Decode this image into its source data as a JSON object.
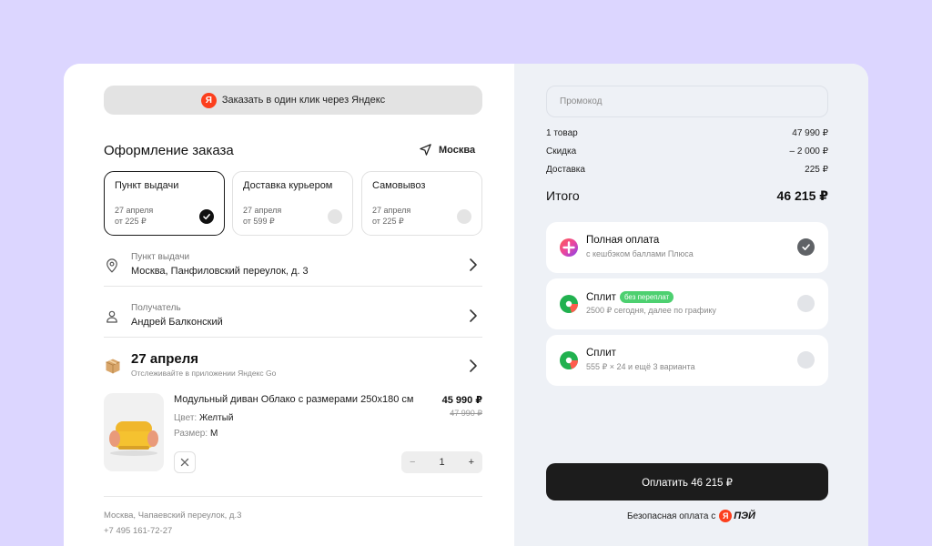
{
  "yandex_button": {
    "logo": "Я",
    "label": "Заказать в один клик через Яндекс"
  },
  "checkout": {
    "title": "Оформление заказа",
    "city": "Москва"
  },
  "delivery_options": [
    {
      "name": "Пункт выдачи",
      "date": "27 апреля",
      "price": "от 225 ₽",
      "selected": true
    },
    {
      "name": "Доставка курьером",
      "date": "27 апреля",
      "price": "от 599 ₽",
      "selected": false
    },
    {
      "name": "Самовывоз",
      "date": "27 апреля",
      "price": "от 225 ₽",
      "selected": false
    }
  ],
  "pickup": {
    "label": "Пункт выдачи",
    "value": "Москва, Панфиловский переулок, д. 3",
    "icon": "location-pin-icon"
  },
  "recipient": {
    "label": "Получатель",
    "value": "Андрей Балконский",
    "icon": "person-icon"
  },
  "shipment": {
    "date": "27 апреля",
    "subtitle": "Отслеживайте в приложении Яндекс Go",
    "icon": "box-icon"
  },
  "product": {
    "name": "Модульный диван Облако с размерами 250х180 см",
    "price": "45 990 ₽",
    "old_price": "47 990 ₽",
    "color_label": "Цвет:",
    "color_value": "Желтый",
    "size_label": "Размер:",
    "size_value": "M",
    "quantity": "1",
    "minus": "−",
    "plus": "+"
  },
  "shop": {
    "address": "Москва, Чапаевский переулок, д.3",
    "phone": "+7 495 161-72-27"
  },
  "summary": {
    "promo_placeholder": "Промокод",
    "rows": [
      {
        "label": "1 товар",
        "value": "47 990 ₽"
      },
      {
        "label": "Скидка",
        "value": "– 2 000 ₽"
      },
      {
        "label": "Доставка",
        "value": "225 ₽"
      }
    ],
    "total_label": "Итого",
    "total_value": "46 215 ₽"
  },
  "payment_options": [
    {
      "title": "Полная оплата",
      "subtitle": "с кешбэком баллами Плюса",
      "badge": "",
      "selected": true,
      "icon": "plus-cashback-icon"
    },
    {
      "title": "Сплит",
      "subtitle": "2500 ₽ сегодня, далее по графику",
      "badge": "без переплат",
      "selected": false,
      "icon": "split-icon"
    },
    {
      "title": "Сплит",
      "subtitle": "555 ₽ × 24 и ещё 3 варианта",
      "badge": "",
      "selected": false,
      "icon": "split-icon"
    }
  ],
  "pay_button": "Оплатить  46 215 ₽",
  "secure": {
    "text": "Безопасная оплата с",
    "logo_text": "ПЭЙ",
    "logo_ya": "Я"
  },
  "colors": {
    "background": "#dcd6ff",
    "accent_red": "#fc3f1d",
    "badge_green": "#4dd070",
    "pay_button": "#1c1c1c"
  }
}
